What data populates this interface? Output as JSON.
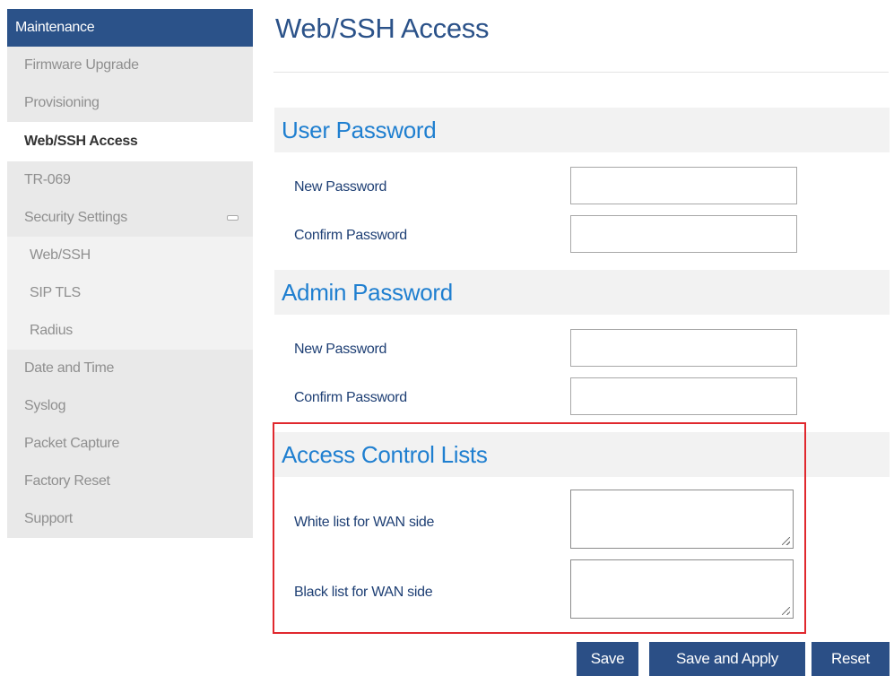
{
  "sidebar": {
    "header": "Maintenance",
    "items": [
      {
        "label": "Firmware Upgrade"
      },
      {
        "label": "Provisioning"
      },
      {
        "label": "Web/SSH Access",
        "active": true
      },
      {
        "label": "TR-069"
      },
      {
        "label": "Security Settings",
        "icon": "collapse-icon"
      },
      {
        "label": "Web/SSH"
      },
      {
        "label": "SIP TLS"
      },
      {
        "label": "Radius"
      },
      {
        "label": "Date and Time"
      },
      {
        "label": "Syslog"
      },
      {
        "label": "Packet Capture"
      },
      {
        "label": "Factory Reset"
      },
      {
        "label": "Support"
      }
    ]
  },
  "main": {
    "title": "Web/SSH Access",
    "user_password": {
      "heading": "User Password",
      "new_label": "New Password",
      "new_value": "",
      "confirm_label": "Confirm Password",
      "confirm_value": ""
    },
    "admin_password": {
      "heading": "Admin Password",
      "new_label": "New Password",
      "new_value": "",
      "confirm_label": "Confirm Password",
      "confirm_value": ""
    },
    "acl": {
      "heading": "Access Control Lists",
      "white_label": "White list for WAN side",
      "white_value": "",
      "black_label": "Black list for WAN side",
      "black_value": ""
    }
  },
  "buttons": {
    "save": "Save",
    "save_apply": "Save and Apply",
    "reset": "Reset"
  },
  "colors": {
    "brand": "#2b5289",
    "section_heading": "#1f7fd0",
    "highlight_border": "#e0282e"
  }
}
